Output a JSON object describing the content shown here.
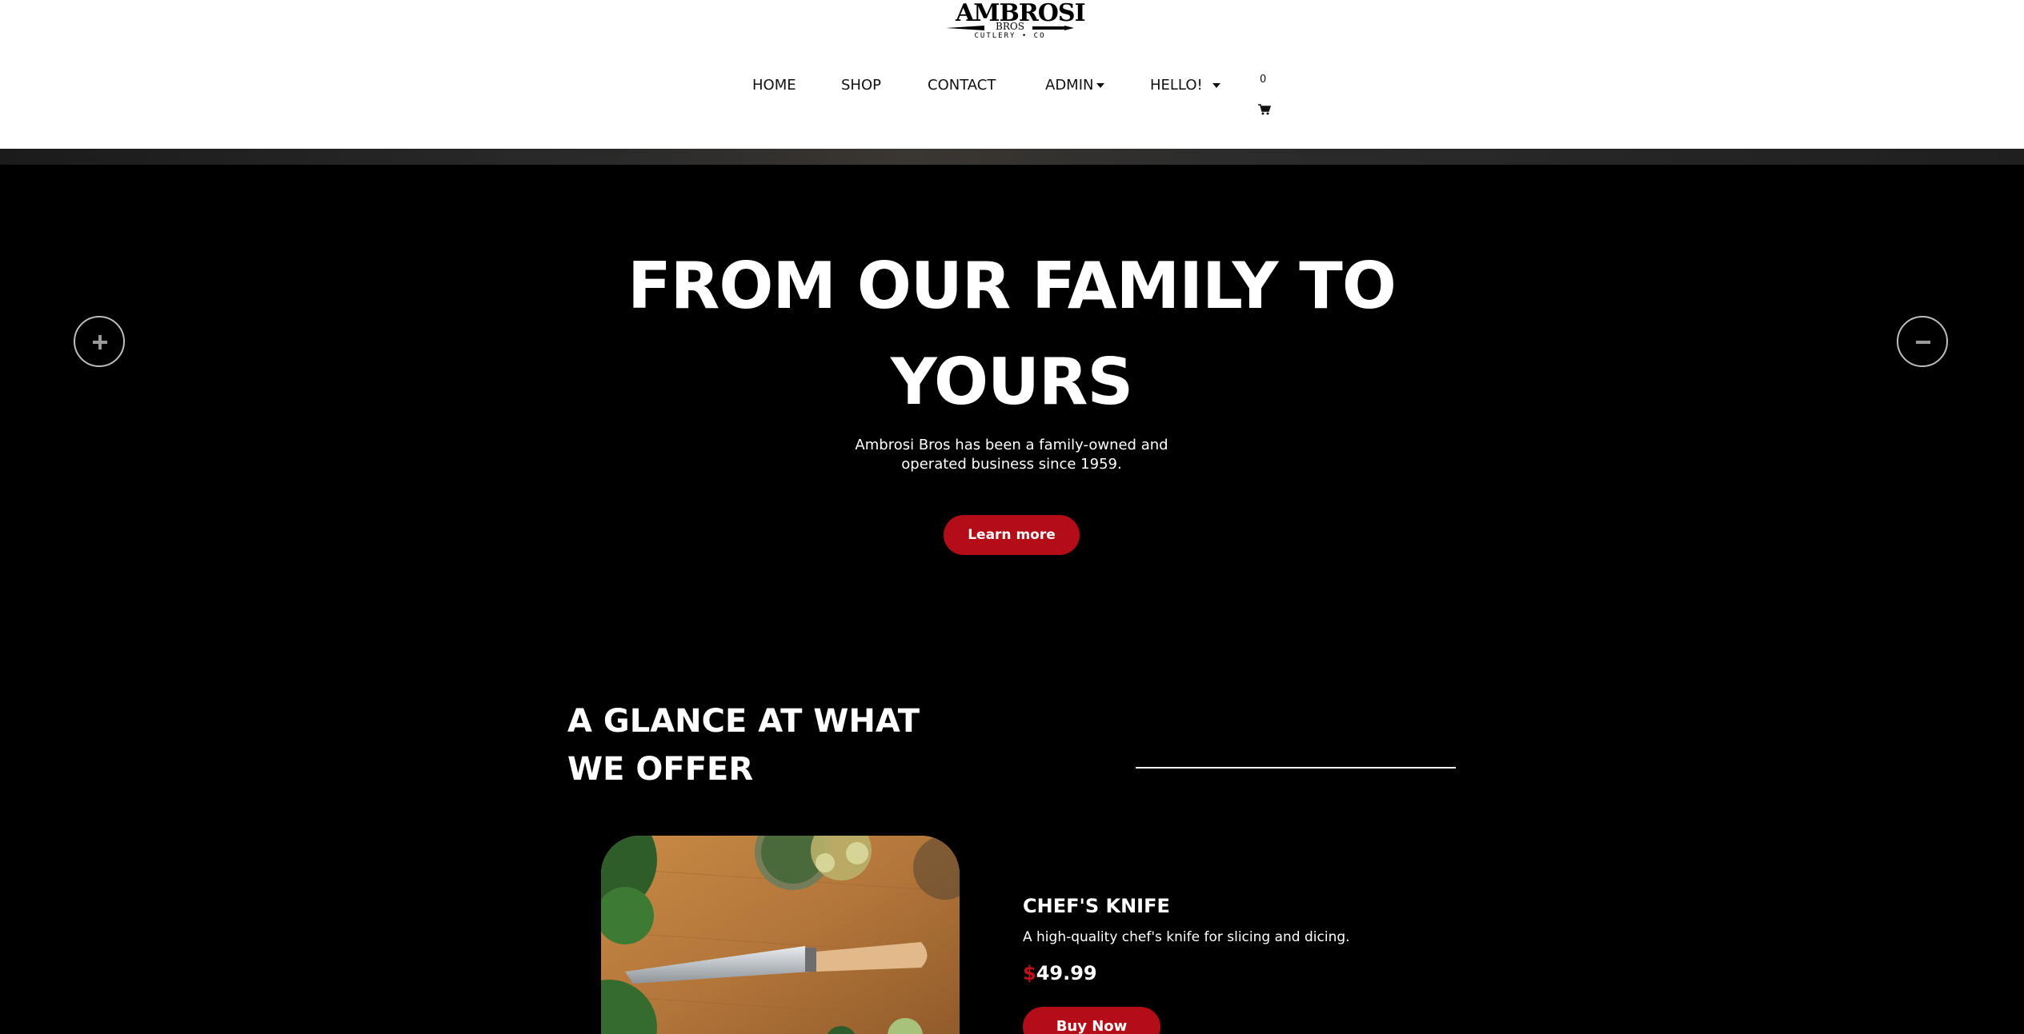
{
  "brand": {
    "name": "AMBROSI",
    "sub_name": "BROS",
    "tagline": "CUTLERY • CO"
  },
  "nav": {
    "items": [
      {
        "label": "HOME",
        "has_dropdown": false
      },
      {
        "label": "SHOP",
        "has_dropdown": false
      },
      {
        "label": "CONTACT",
        "has_dropdown": false
      },
      {
        "label": "ADMIN",
        "has_dropdown": true
      },
      {
        "label": "HELLO!",
        "has_dropdown": true
      }
    ],
    "cart_count": "0",
    "cart_icon": "shopping-cart-icon"
  },
  "hero": {
    "title": "FROM OUR FAMILY TO YOURS",
    "text": "Ambrosi Bros has been a family-owned and operated business since 1959.",
    "button_label": "Learn more",
    "prev_icon": "plus-icon",
    "next_icon": "minus-icon"
  },
  "offer": {
    "title": "A GLANCE AT WHAT WE OFFER"
  },
  "product": {
    "name": "CHEF'S KNIFE",
    "description": "A high-quality chef's knife for slicing and dicing.",
    "currency": "$",
    "price": "49.99",
    "button_label": "Buy Now"
  },
  "colors": {
    "accent": "#b40d17",
    "price_currency": "#c0111b",
    "header_bg": "#ffffff",
    "page_bg": "#000000"
  }
}
